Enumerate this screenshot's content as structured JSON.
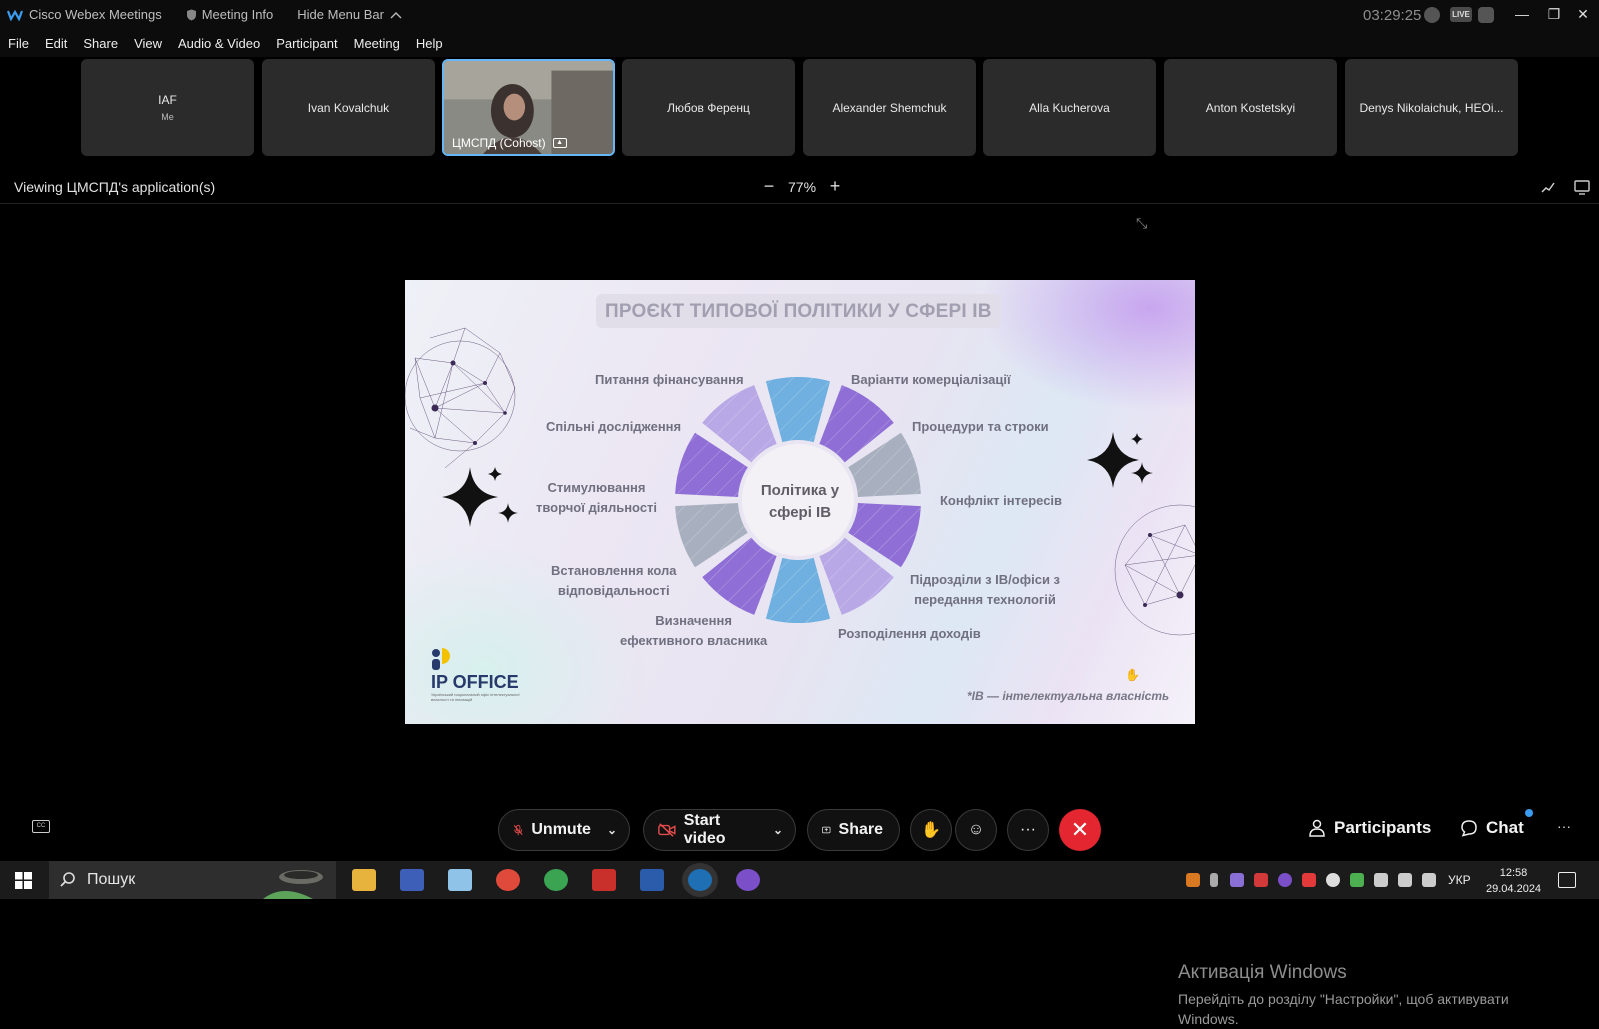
{
  "titlebar": {
    "app_name": "Cisco Webex Meetings",
    "meeting_info": "Meeting Info",
    "hide_menu": "Hide Menu Bar",
    "clock": "03:29:25",
    "live_badge": "LIVE"
  },
  "menu": [
    "File",
    "Edit",
    "Share",
    "View",
    "Audio & Video",
    "Participant",
    "Meeting",
    "Help"
  ],
  "participants": [
    {
      "name": "IAF",
      "sub": "Me"
    },
    {
      "name": "Ivan Kovalchuk",
      "sub": ""
    },
    {
      "name": "ЦМСПД (Cohost)",
      "sub": "",
      "active": true
    },
    {
      "name": "Любов Ференц",
      "sub": ""
    },
    {
      "name": "Alexander Shemchuk",
      "sub": ""
    },
    {
      "name": "Alla Kucherova",
      "sub": ""
    },
    {
      "name": "Anton Kostetskyi",
      "sub": ""
    },
    {
      "name": "Denys Nikolaichuk, HEOi...",
      "sub": ""
    }
  ],
  "viewbar": {
    "viewing": "Viewing ЦМСПД's application(s)",
    "zoom": "77%"
  },
  "slide": {
    "title": "ПРОЄКТ ТИПОВОЇ ПОЛІТИКИ У СФЕРІ ІВ",
    "center_line1": "Політика у",
    "center_line2": "сфері ІВ",
    "labels": {
      "l1": "Питання фінансування",
      "l2": "Спільні дослідження",
      "l3a": "Стимулювання",
      "l3b": "творчої діяльності",
      "l4a": "Встановлення кола",
      "l4b": "відповідальності",
      "l5a": "Визначення",
      "l5b": "ефективного власника",
      "r1": "Варіанти комерціалізації",
      "r2": "Процедури та строки",
      "r3": "Конфлікт інтересів",
      "r4a": "Підрозділи з ІВ/офіси з",
      "r4b": "передання технологій",
      "r5": "Розподілення доходів"
    },
    "footnote": "*ІВ — інтелектуальна власність",
    "logo_text": "IP OFFICE",
    "logo_small": "Український національний офіс інтелектуальної власності та інновацій"
  },
  "activation": {
    "line1": "Активація Windows",
    "line2": "Перейдіть до розділу \"Настройки\", щоб активувати",
    "line3": "Windows."
  },
  "controls": {
    "unmute": "Unmute",
    "start_video": "Start video",
    "share": "Share",
    "participants": "Participants",
    "chat": "Chat",
    "more": "···"
  },
  "taskbar": {
    "search": "Пошук",
    "lang": "УКР",
    "time": "12:58",
    "date": "29.04.2024"
  },
  "colors": {
    "accent": "#67b6f5",
    "end_call": "#e3262f",
    "wheel_purple": "#8f6fd6",
    "wheel_blue": "#6fb0e0",
    "wheel_gray": "#a8b0c0"
  }
}
